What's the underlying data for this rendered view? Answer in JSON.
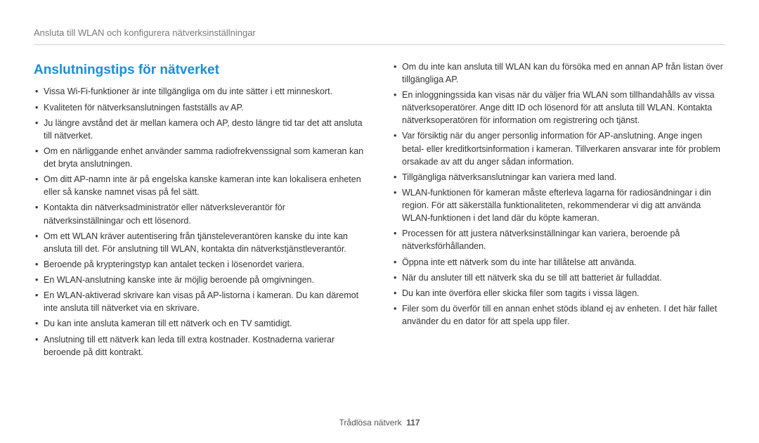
{
  "breadcrumb": "Ansluta till WLAN och konfigurera nätverksinställningar",
  "section_title": "Anslutningstips för nätverket",
  "left_items": [
    "Vissa Wi-Fi-funktioner är inte tillgängliga om du inte sätter i ett minneskort.",
    "Kvaliteten för nätverksanslutningen fastställs av AP.",
    "Ju längre avstånd det är mellan kamera och AP, desto längre tid tar det att ansluta till nätverket.",
    "Om en närliggande enhet använder samma radiofrekvenssignal som kameran kan det bryta anslutningen.",
    "Om ditt AP-namn inte är på engelska kanske kameran inte kan lokalisera enheten eller så kanske namnet visas på fel sätt.",
    "Kontakta din nätverksadministratör eller nätverksleverantör för nätverksinställningar och ett lösenord.",
    "Om ett WLAN kräver autentisering från tjänsteleverantören kanske du inte kan ansluta till det. För anslutning till WLAN, kontakta din nätverkstjänstleverantör.",
    "Beroende på krypteringstyp kan antalet tecken i lösenordet variera.",
    "En WLAN-anslutning kanske inte är möjlig beroende på omgivningen.",
    "En WLAN-aktiverad skrivare kan visas på AP-listorna i kameran. Du kan däremot inte ansluta till nätverket via en skrivare.",
    "Du kan inte ansluta kameran till ett nätverk och en TV samtidigt.",
    "Anslutning till ett nätverk kan leda till extra kostnader. Kostnaderna varierar beroende på ditt kontrakt."
  ],
  "right_items": [
    "Om du inte kan ansluta till WLAN kan du försöka med en annan AP från listan över tillgängliga AP.",
    "En inloggningssida kan visas när du väljer fria WLAN som tillhandahålls av vissa nätverksoperatörer. Ange ditt ID och lösenord för att ansluta till WLAN. Kontakta nätverksoperatören för information om registrering och tjänst.",
    "Var försiktig när du anger personlig information för AP-anslutning. Ange ingen betal- eller kreditkortsinformation i kameran. Tillverkaren ansvarar inte för problem orsakade av att du anger sådan information.",
    "Tillgängliga nätverksanslutningar kan variera med land.",
    "WLAN-funktionen för kameran måste efterleva lagarna för radiosändningar i din region. För att säkerställa funktionaliteten, rekommenderar vi dig att använda WLAN-funktionen i det land där du köpte kameran.",
    "Processen för att justera nätverksinställningar kan variera, beroende på nätverksförhållanden.",
    "Öppna inte ett nätverk som du inte har tillåtelse att använda.",
    "När du ansluter till ett nätverk ska du se till att batteriet är fulladdat.",
    "Du kan inte överföra eller skicka filer som tagits i vissa lägen.",
    "Filer som du överför till en annan enhet stöds ibland ej av enheten. I det här fallet använder du en dator för att spela upp filer."
  ],
  "footer_label": "Trådlösa nätverk",
  "page_number": "117"
}
